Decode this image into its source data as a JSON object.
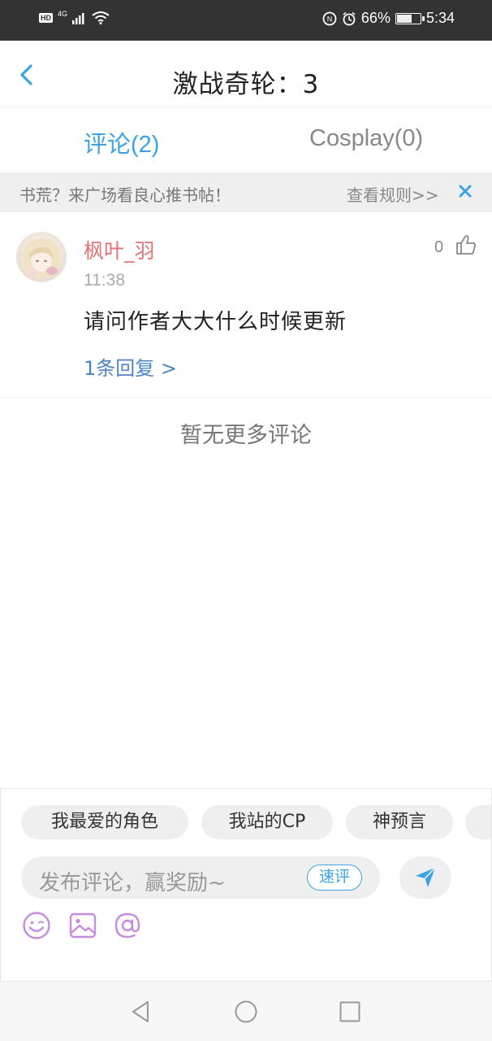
{
  "status_bar": {
    "hd": "HD",
    "network": "4G",
    "battery": "66%",
    "battery_level": 0.66,
    "time": "5:34"
  },
  "header": {
    "title": "激战奇轮：3"
  },
  "tabs": [
    {
      "label": "评论(2)",
      "active": true
    },
    {
      "label": "Cosplay(0)",
      "active": false
    }
  ],
  "notice": {
    "text": "书荒？来广场看良心推书帖！",
    "link": "查看规则>>"
  },
  "comments": [
    {
      "username": "枫叶_羽",
      "time": "11:38",
      "text": "请问作者大大什么时候更新",
      "likes": "0",
      "replies": "1条回复 >"
    }
  ],
  "no_more_text": "暂无更多评论",
  "compose": {
    "chips": [
      "我最爱的角色",
      "我站的CP",
      "神预言"
    ],
    "placeholder": "发布评论，赢奖励~",
    "quick_label": "速评"
  },
  "colors": {
    "accent": "#3aa3e3",
    "username": "#e57373",
    "link": "#4f83c4",
    "tool_icons": "#c58be0"
  }
}
